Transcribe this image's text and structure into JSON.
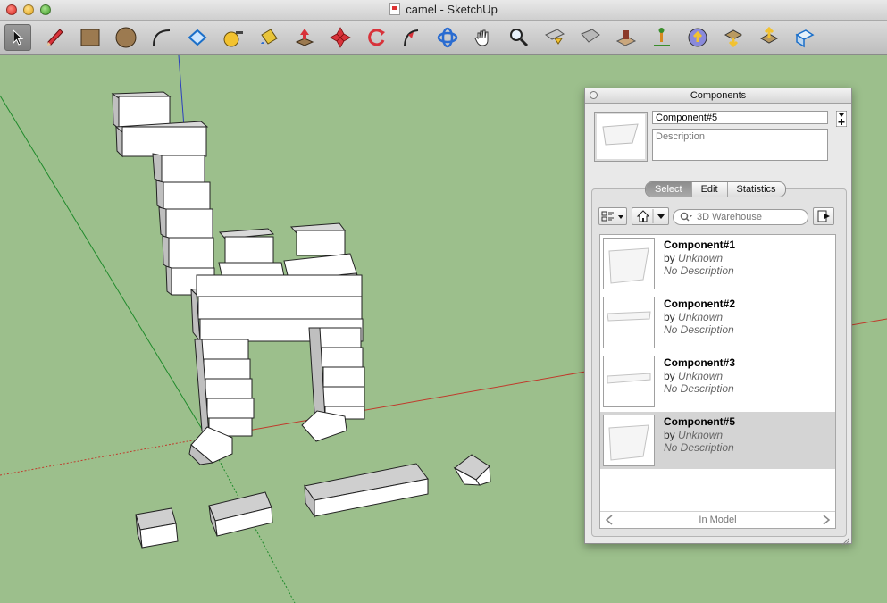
{
  "window": {
    "title": "camel - SketchUp"
  },
  "toolbar": {
    "tools": [
      "select-tool-icon",
      "pencil-tool-icon",
      "rectangle-tool-icon",
      "circle-tool-icon",
      "arc-tool-icon",
      "make-component-icon",
      "tape-measure-icon",
      "paint-bucket-icon",
      "push-pull-icon",
      "move-icon",
      "rotate-icon",
      "follow-me-icon",
      "orbit-icon",
      "pan-icon",
      "zoom-icon",
      "zoom-extents-icon",
      "previous-view-icon",
      "add-location-icon",
      "toggle-terrain-icon",
      "get-models-icon",
      "share-model-icon",
      "share-component-icon",
      "extension-warehouse-icon"
    ]
  },
  "components_panel": {
    "title": "Components",
    "name_value": "Component#5",
    "description_placeholder": "Description",
    "tabs": [
      "Select",
      "Edit",
      "Statistics"
    ],
    "active_tab": "Select",
    "search_placeholder": "3D Warehouse",
    "footer_label": "In Model",
    "items": [
      {
        "name": "Component#1",
        "by": "by",
        "author": "Unknown",
        "description": "No Description"
      },
      {
        "name": "Component#2",
        "by": "by",
        "author": "Unknown",
        "description": "No Description"
      },
      {
        "name": "Component#3",
        "by": "by",
        "author": "Unknown",
        "description": "No Description"
      },
      {
        "name": "Component#5",
        "by": "by",
        "author": "Unknown",
        "description": "No Description"
      }
    ],
    "selected_item": "Component#5"
  },
  "colors": {
    "viewport_bg": "#9cbf8c",
    "red_axis": "#c0392b",
    "green_axis": "#1f8a2b",
    "blue_axis": "#2b3fbf"
  }
}
